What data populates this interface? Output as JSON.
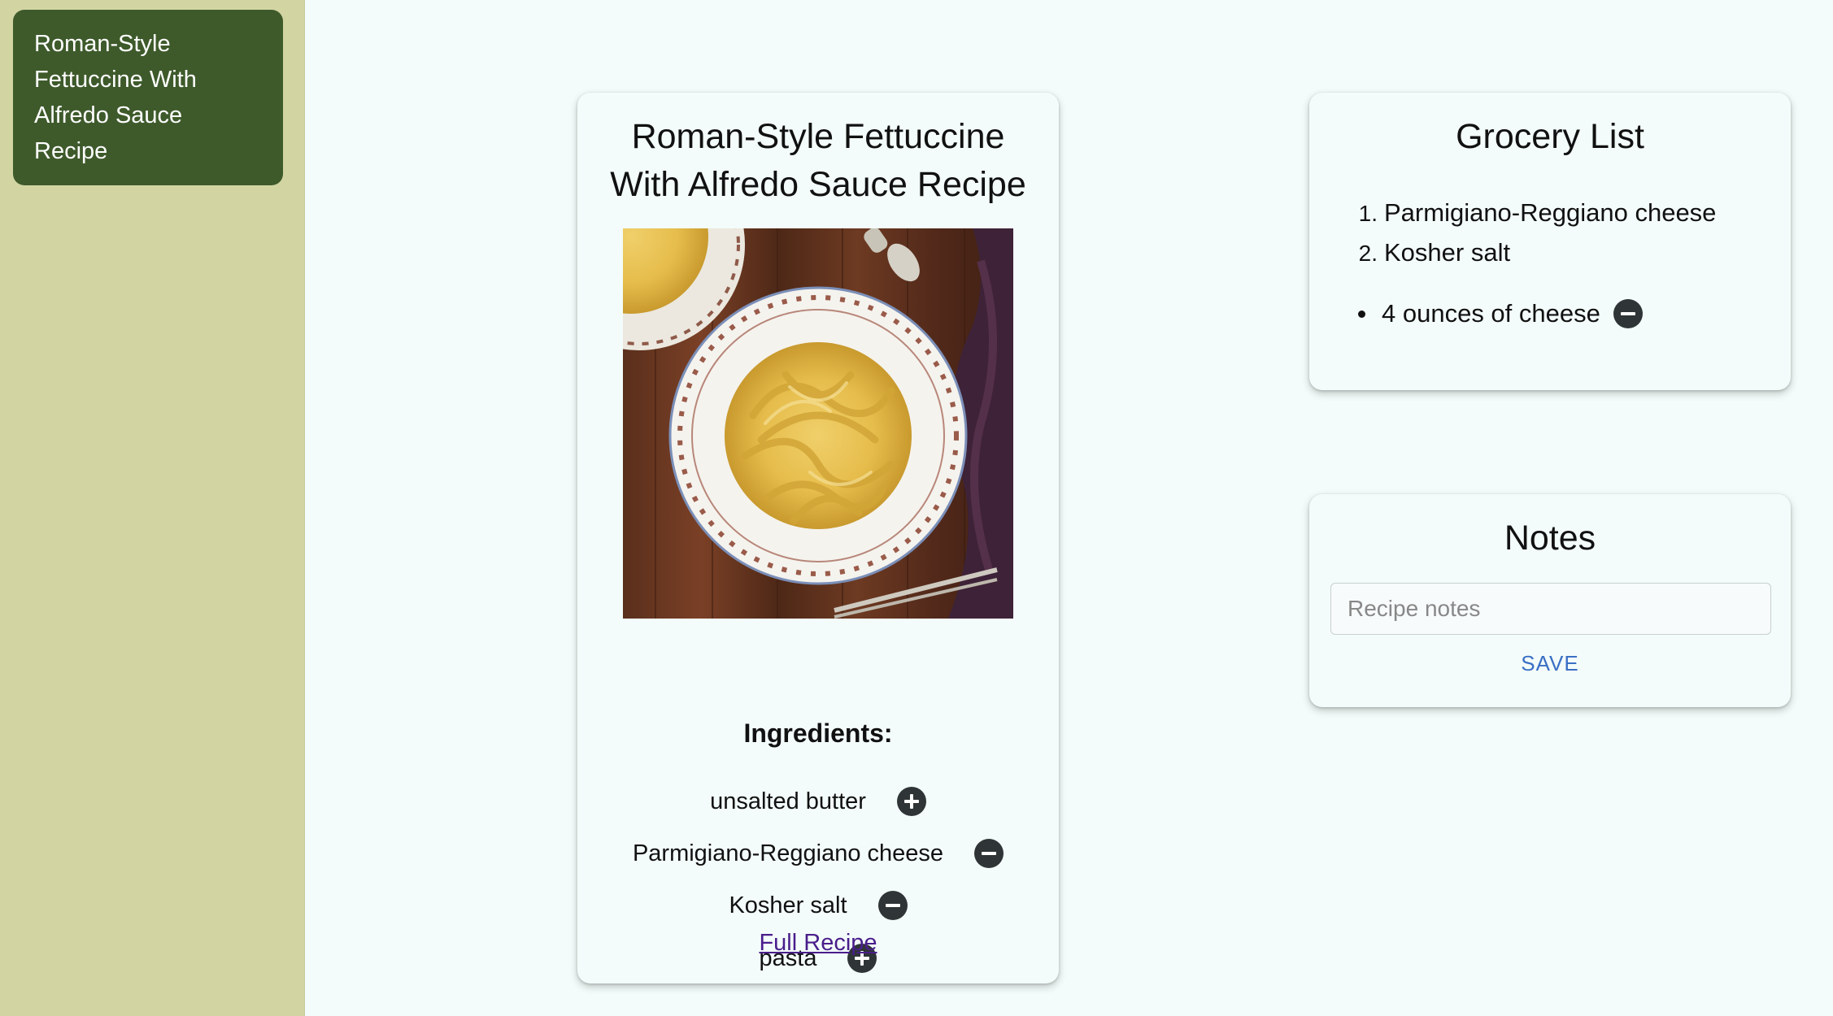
{
  "sidebar": {
    "items": [
      {
        "label": "Roman-Style Fettuccine With Alfredo Sauce Recipe"
      }
    ]
  },
  "recipe": {
    "title": "Roman-Style Fettuccine With Alfredo Sauce Recipe",
    "ingredients_heading": "Ingredients:",
    "ingredients": [
      {
        "name": "unsalted butter",
        "action": "add"
      },
      {
        "name": "Parmigiano-Reggiano cheese",
        "action": "remove"
      },
      {
        "name": "Kosher salt",
        "action": "remove"
      },
      {
        "name": "pasta",
        "action": "add"
      }
    ],
    "full_recipe_link": "Full Recipe"
  },
  "grocery": {
    "title": "Grocery List",
    "ordered_items": [
      "Parmigiano-Reggiano cheese",
      "Kosher salt"
    ],
    "custom_items": [
      "4 ounces of cheese"
    ]
  },
  "notes": {
    "title": "Notes",
    "placeholder": "Recipe notes",
    "value": "",
    "save_label": "SAVE"
  },
  "colors": {
    "sidebar_bg": "#d2d5a2",
    "sidebar_item_bg": "#3e5a2b",
    "page_bg": "#f3fcfa",
    "link": "#4a1e8c",
    "save_button": "#3a6fc4",
    "icon_button": "#2f3436"
  }
}
